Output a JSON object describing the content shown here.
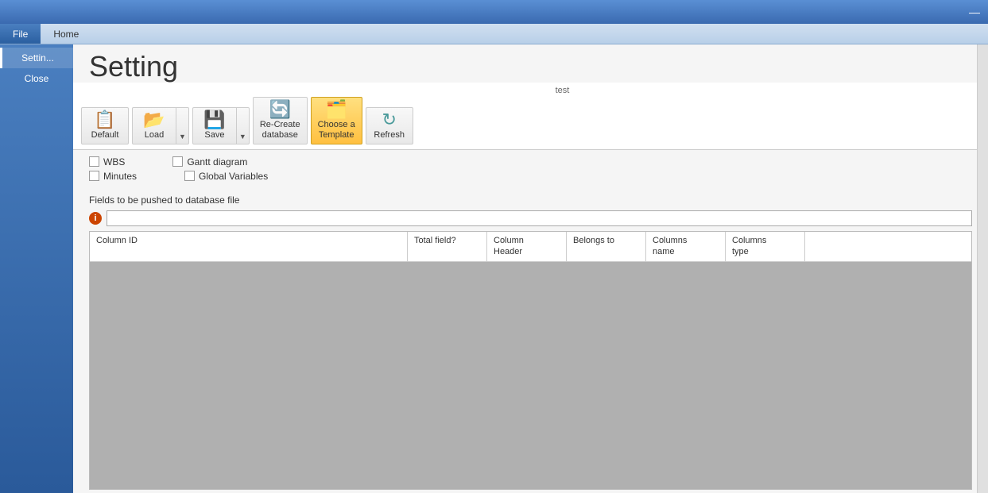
{
  "titlebar": {
    "minimize_icon": "—"
  },
  "menubar": {
    "file_label": "File",
    "home_label": "Home"
  },
  "sidebar": {
    "active_item": "Settin...",
    "close_label": "Close"
  },
  "page": {
    "title": "Setting",
    "ribbon_group_label": "test"
  },
  "ribbon": {
    "default_label": "Default",
    "load_label": "Load",
    "save_label": "Save",
    "recreate_label": "Re-Create\ndatabase",
    "choose_label": "Choose a\nTemplate",
    "refresh_label": "Refresh"
  },
  "checkboxes": {
    "wbs_label": "WBS",
    "minutes_label": "Minutes",
    "gantt_label": "Gantt diagram",
    "global_label": "Global Variables"
  },
  "fields": {
    "push_label": "Fields to be pushed to database file"
  },
  "table": {
    "col_id": "Column ID",
    "col_total": "Total field?",
    "col_header": "Column\nHeader",
    "col_belongs": "Belongs to",
    "col_name": "Columns\nname",
    "col_type": "Columns\ntype"
  }
}
